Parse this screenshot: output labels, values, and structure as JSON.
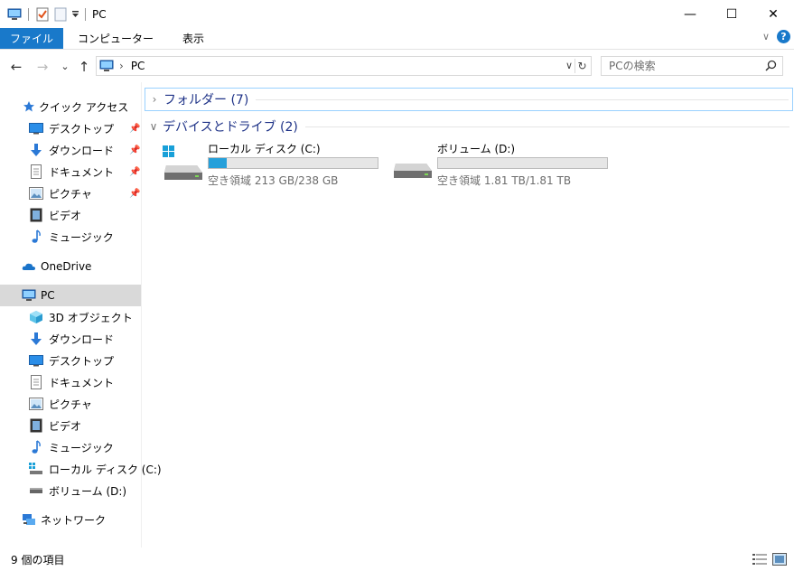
{
  "window": {
    "title": "PC",
    "minimize_glyph": "—",
    "maximize_glyph": "☐",
    "close_glyph": "✕"
  },
  "ribbon": {
    "tabs": [
      "ファイル",
      "コンピューター",
      "表示"
    ],
    "collapse_glyph": "∨",
    "help_glyph": "?"
  },
  "address": {
    "back_glyph": "←",
    "forward_glyph": "→",
    "recent_glyph": "⌄",
    "up_glyph": "↑",
    "separator": "›",
    "crumb": "PC",
    "dropdown_glyph": "∨",
    "refresh_glyph": "↻"
  },
  "search": {
    "placeholder": "PCの検索"
  },
  "nav": {
    "quick_access": "クイック アクセス",
    "quick_items": [
      "デスクトップ",
      "ダウンロード",
      "ドキュメント",
      "ピクチャ",
      "ビデオ",
      "ミュージック"
    ],
    "onedrive": "OneDrive",
    "pc": "PC",
    "pc_items": [
      "3D オブジェクト",
      "ダウンロード",
      "デスクトップ",
      "ドキュメント",
      "ピクチャ",
      "ビデオ",
      "ミュージック",
      "ローカル ディスク (C:)",
      "ボリューム (D:)"
    ],
    "network": "ネットワーク"
  },
  "content": {
    "group_folders": "フォルダー (7)",
    "group_drives": "デバイスとドライブ (2)",
    "collapsed_chev": "›",
    "expanded_chev": "∨",
    "drives": [
      {
        "name": "ローカル ディスク (C:)",
        "free": "空き領域 213 GB/238 GB",
        "used_fraction": 0.105
      },
      {
        "name": "ボリューム (D:)",
        "free": "空き領域 1.81 TB/1.81 TB",
        "used_fraction": 0.0
      }
    ]
  },
  "status": {
    "item_count": "9 個の項目"
  },
  "colors": {
    "accent": "#1979ca",
    "drive_bar": "#26a0da",
    "group_text": "#1e3287",
    "selection": "#d9d9d9"
  }
}
